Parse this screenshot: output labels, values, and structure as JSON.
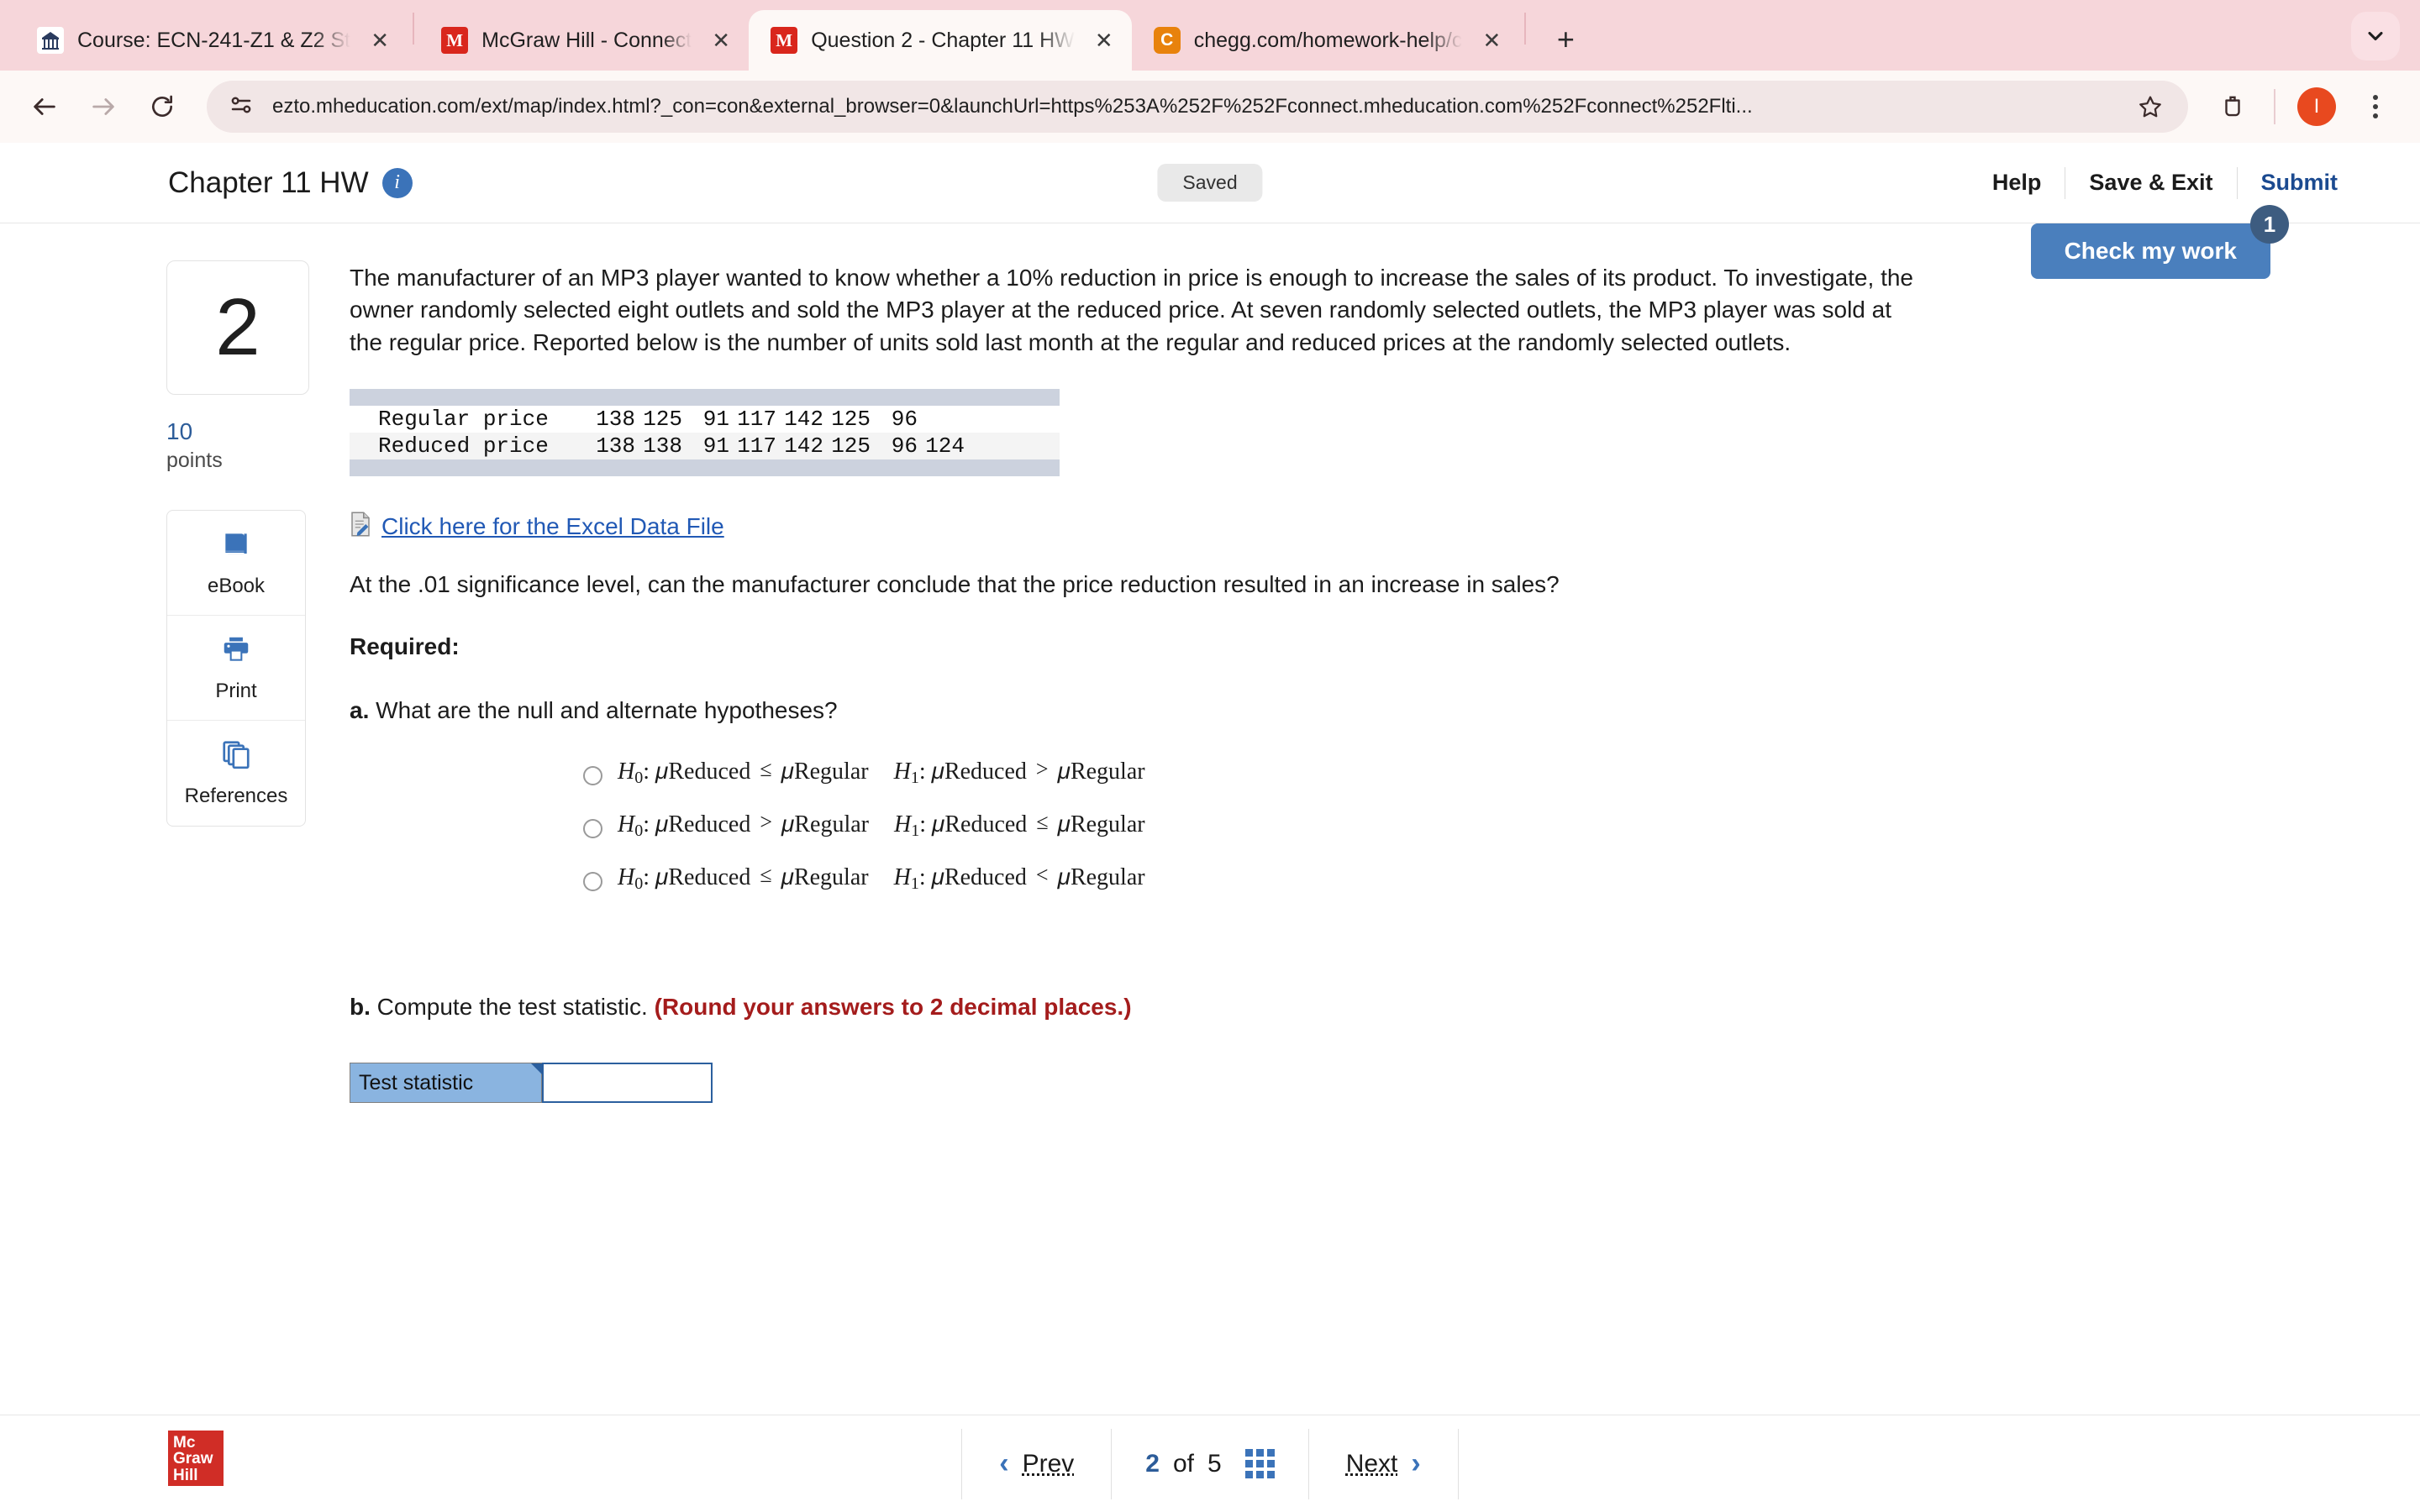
{
  "browser": {
    "tabs": [
      {
        "title": "Course: ECN-241-Z1 & Z2 St",
        "favicon": "canvas-icon",
        "active": false
      },
      {
        "title": "McGraw Hill - Connect",
        "favicon": "mcgraw-hill-icon",
        "active": false
      },
      {
        "title": "Question 2 - Chapter 11 HW",
        "favicon": "mcgraw-hill-icon",
        "active": true
      },
      {
        "title": "chegg.com/homework-help/c",
        "favicon": "chegg-icon",
        "active": false
      }
    ],
    "new_tab_label": "+",
    "close_label": "✕",
    "tab_list_icon": "chevron-down-icon",
    "toolbar": {
      "back_icon": "back-arrow-icon",
      "forward_icon": "forward-arrow-icon",
      "reload_icon": "reload-icon",
      "site_info_icon": "site-settings-icon",
      "url": "ezto.mheducation.com/ext/map/index.html?_con=con&external_browser=0&launchUrl=https%253A%252F%252Fconnect.mheducation.com%252Fconnect%252Flti...",
      "bookmark_icon": "star-icon",
      "extensions_icon": "extensions-icon",
      "profile_initial": "I",
      "menu_icon": "kebab-menu-icon"
    }
  },
  "header": {
    "title": "Chapter 11 HW",
    "info_icon": "info-icon",
    "status": "Saved",
    "links": [
      {
        "label": "Help",
        "style": "normal"
      },
      {
        "label": "Save & Exit",
        "style": "normal"
      },
      {
        "label": "Submit",
        "style": "submit"
      }
    ]
  },
  "check_my_work": {
    "label": "Check my work",
    "count": "1"
  },
  "rail": {
    "question_number": "2",
    "points_value": "10",
    "points_label": "points",
    "tools": [
      {
        "label": "eBook",
        "icon": "book-icon"
      },
      {
        "label": "Print",
        "icon": "printer-icon"
      },
      {
        "label": "References",
        "icon": "pages-icon"
      }
    ]
  },
  "question": {
    "prompt": "The manufacturer of an MP3 player wanted to know whether a 10% reduction in price is enough to increase the sales of its product. To investigate, the owner randomly selected eight outlets and sold the MP3 player at the reduced price. At seven randomly selected outlets, the MP3 player was sold at the regular price. Reported below is the number of units sold last month at the regular and reduced prices at the randomly selected outlets.",
    "table": {
      "rows": [
        {
          "label": "Regular price",
          "values": [
            "138",
            "125",
            "91",
            "117",
            "142",
            "125",
            "96",
            ""
          ]
        },
        {
          "label": "Reduced price",
          "values": [
            "138",
            "138",
            "91",
            "117",
            "142",
            "125",
            "96",
            "124"
          ]
        }
      ]
    },
    "excel_link": "Click here for the Excel Data File",
    "excel_icon": "excel-file-icon",
    "significance_line": "At the .01 significance level, can the manufacturer conclude that the price reduction resulted in an increase in sales?",
    "required_label": "Required:",
    "part_a": {
      "letter": "a.",
      "text": "What are the null and alternate hypotheses?"
    },
    "options": [
      {
        "null": {
          "sym": "H",
          "sub": "0",
          "left": "Reduced",
          "op": "≤",
          "right": "Regular"
        },
        "alt": {
          "sym": "H",
          "sub": "1",
          "left": "Reduced",
          "op": ">",
          "right": "Regular"
        },
        "selected": false
      },
      {
        "null": {
          "sym": "H",
          "sub": "0",
          "left": "Reduced",
          "op": ">",
          "right": "Regular"
        },
        "alt": {
          "sym": "H",
          "sub": "1",
          "left": "Reduced",
          "op": "≤",
          "right": "Regular"
        },
        "selected": false
      },
      {
        "null": {
          "sym": "H",
          "sub": "0",
          "left": "Reduced",
          "op": "≤",
          "right": "Regular"
        },
        "alt": {
          "sym": "H",
          "sub": "1",
          "left": "Reduced",
          "op": "<",
          "right": "Regular"
        },
        "selected": false
      }
    ],
    "part_b": {
      "letter": "b.",
      "text": "Compute the test statistic.",
      "note": "(Round your answers to 2 decimal places.)"
    },
    "answer": {
      "label": "Test statistic",
      "value": "",
      "placeholder": ""
    }
  },
  "footer": {
    "logo_lines": [
      "Mc",
      "Graw",
      "Hill"
    ],
    "prev_label": "Prev",
    "next_label": "Next",
    "current_page": "2",
    "of_label": "of",
    "total_pages": "5",
    "grid_icon": "grid-view-icon"
  },
  "colors": {
    "accent_blue": "#3b73b9",
    "submit_blue": "#1b4a90",
    "check_button": "#4a7fbd",
    "note_red": "#a41c1c",
    "mcgraw_red": "#d02d26",
    "answer_label_blue": "#8ab4e0"
  }
}
